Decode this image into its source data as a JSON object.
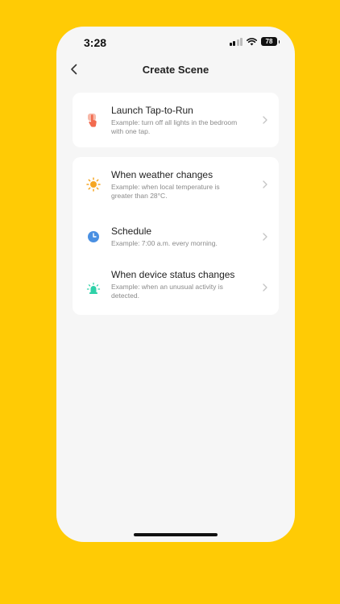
{
  "status_bar": {
    "time": "3:28",
    "battery": "78",
    "icons": [
      "signal-icon",
      "wifi-icon",
      "battery-icon"
    ]
  },
  "nav": {
    "back_icon": "chevron-left-icon",
    "title": "Create Scene"
  },
  "sections": [
    {
      "items": [
        {
          "title": "Launch Tap-to-Run",
          "description": "Example: turn off all lights in the bedroom with one tap.",
          "icon": "tap-hand-icon",
          "icon_color": "#F26B4F"
        }
      ]
    },
    {
      "items": [
        {
          "title": "When weather changes",
          "description": "Example: when local temperature is greater than 28°C.",
          "icon": "sun-icon",
          "icon_color": "#F5A623"
        },
        {
          "title": "Schedule",
          "description": "Example: 7:00 a.m. every morning.",
          "icon": "clock-icon",
          "icon_color": "#4A90E2"
        },
        {
          "title": "When device status changes",
          "description": "Example: when an unusual activity is detected.",
          "icon": "device-alarm-icon",
          "icon_color": "#2ED1A8"
        }
      ]
    }
  ],
  "colors": {
    "background": "#FFCB05",
    "screen": "#F6F6F6",
    "card": "#FFFFFF",
    "chevron": "#C4C4C4"
  }
}
